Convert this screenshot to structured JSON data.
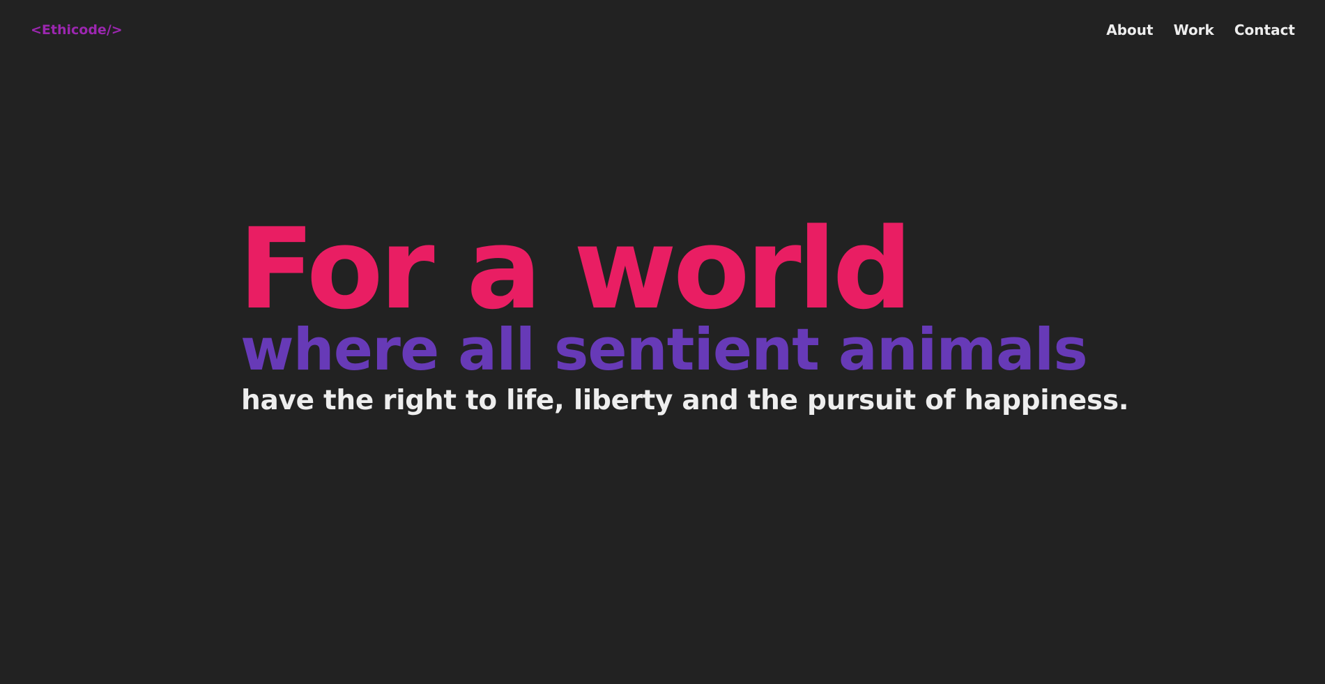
{
  "header": {
    "logo": "<Ethicode/>",
    "nav": {
      "about": "About",
      "work": "Work",
      "contact": "Contact"
    }
  },
  "hero": {
    "line1": "For a world",
    "line2": "where all sentient animals",
    "line3": "have the right to life, liberty and the pursuit of happiness."
  },
  "colors": {
    "background": "#222222",
    "logo": "#9c27b0",
    "headline": "#e91e63",
    "subheadline": "#673ab7",
    "body_text": "#eeeeee"
  }
}
